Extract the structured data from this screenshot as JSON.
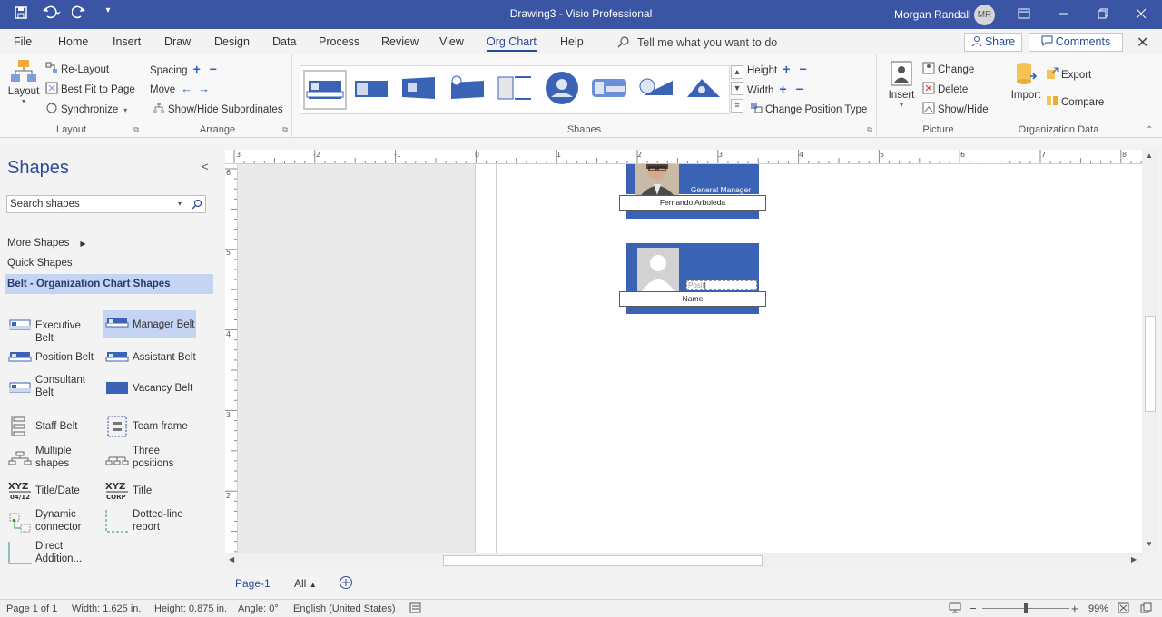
{
  "window": {
    "title": "Drawing3  -  Visio Professional",
    "user_name": "Morgan Randall",
    "user_initials": "MR"
  },
  "menu": {
    "tabs": [
      "File",
      "Home",
      "Insert",
      "Draw",
      "Design",
      "Data",
      "Process",
      "Review",
      "View",
      "Org Chart",
      "Help"
    ],
    "active_tab": "Org Chart",
    "tell_me": "Tell me what you want to do",
    "share": "Share",
    "comments": "Comments"
  },
  "ribbon": {
    "layout": {
      "label": "Layout",
      "layout_btn": "Layout",
      "relayout": "Re-Layout",
      "best_fit": "Best Fit to Page",
      "synchronize": "Synchronize"
    },
    "arrange": {
      "label": "Arrange",
      "spacing": "Spacing",
      "move": "Move",
      "show_hide_subordinates": "Show/Hide Subordinates"
    },
    "shapes": {
      "label": "Shapes",
      "height": "Height",
      "width": "Width",
      "change_position_type": "Change Position Type"
    },
    "picture": {
      "label": "Picture",
      "insert": "Insert",
      "change": "Change",
      "delete": "Delete",
      "show_hide": "Show/Hide"
    },
    "org_data": {
      "label": "Organization Data",
      "import": "Import",
      "export": "Export",
      "compare": "Compare"
    }
  },
  "shapes_panel": {
    "title": "Shapes",
    "search_placeholder": "Search shapes",
    "more_shapes": "More Shapes",
    "quick_shapes": "Quick Shapes",
    "stencil": "Belt - Organization Chart Shapes",
    "items": [
      "Executive Belt",
      "Manager Belt",
      "Position Belt",
      "Assistant Belt",
      "Consultant Belt",
      "Vacancy Belt",
      "Staff Belt",
      "Team frame",
      "Multiple shapes",
      "Three positions",
      "Title/Date",
      "Title",
      "Dynamic connector",
      "Dotted-line report",
      "Direct Addition..."
    ],
    "icon_text": {
      "xyz": "XYZ",
      "date": "04/12",
      "corp": "CORP"
    }
  },
  "canvas": {
    "ruler_top": [
      "3",
      "-2",
      "-1",
      "0",
      "1",
      "2",
      "3",
      "4",
      "5",
      "6",
      "7",
      "8"
    ],
    "ruler_left": [
      "6",
      "5",
      "4",
      "3",
      "2"
    ],
    "card1": {
      "title": "General Manager",
      "name": "Fernando Arboleda"
    },
    "card2": {
      "title": "Posit",
      "name": "Name"
    }
  },
  "page_tabs": {
    "page": "Page-1",
    "all": "All"
  },
  "status": {
    "page": "Page 1 of 1",
    "width": "Width: 1.625 in.",
    "height": "Height: 0.875 in.",
    "angle": "Angle: 0°",
    "language": "English (United States)",
    "zoom": "99%"
  },
  "colors": {
    "title_bar": "#3955a3",
    "accent": "#2b4a99",
    "belt_blue": "#3a62b5",
    "stencil_highlight": "#c5d4f2"
  }
}
